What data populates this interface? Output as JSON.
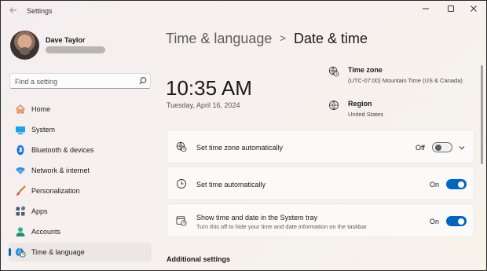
{
  "window": {
    "title": "Settings"
  },
  "user": {
    "name": "Dave Taylor"
  },
  "search": {
    "placeholder": "Find a setting"
  },
  "nav": {
    "items": [
      {
        "label": "Home",
        "icon": "home-icon"
      },
      {
        "label": "System",
        "icon": "monitor-icon"
      },
      {
        "label": "Bluetooth & devices",
        "icon": "bluetooth-icon"
      },
      {
        "label": "Network & internet",
        "icon": "wifi-icon"
      },
      {
        "label": "Personalization",
        "icon": "brush-icon"
      },
      {
        "label": "Apps",
        "icon": "apps-icon"
      },
      {
        "label": "Accounts",
        "icon": "person-icon"
      },
      {
        "label": "Time & language",
        "icon": "clock-globe-icon",
        "active": true
      }
    ]
  },
  "breadcrumb": {
    "parent": "Time & language",
    "separator": ">",
    "current": "Date & time"
  },
  "clock": {
    "time": "10:35 AM",
    "date": "Tuesday, April 16, 2024"
  },
  "timezone": {
    "title": "Time zone",
    "value": "(UTC-07:00) Mountain Time (US & Canada)"
  },
  "region": {
    "title": "Region",
    "value": "United States"
  },
  "settings": [
    {
      "label": "Set time zone automatically",
      "state": "Off",
      "on": false
    },
    {
      "label": "Set time automatically",
      "state": "On",
      "on": true
    },
    {
      "label": "Show time and date in the System tray",
      "sublabel": "Turn this off to hide your time and date information on the taskbar",
      "state": "On",
      "on": true
    }
  ],
  "sections": {
    "additional": "Additional settings"
  },
  "colors": {
    "accent": "#0067c0",
    "active_nav_bg": "#ece7e6"
  }
}
